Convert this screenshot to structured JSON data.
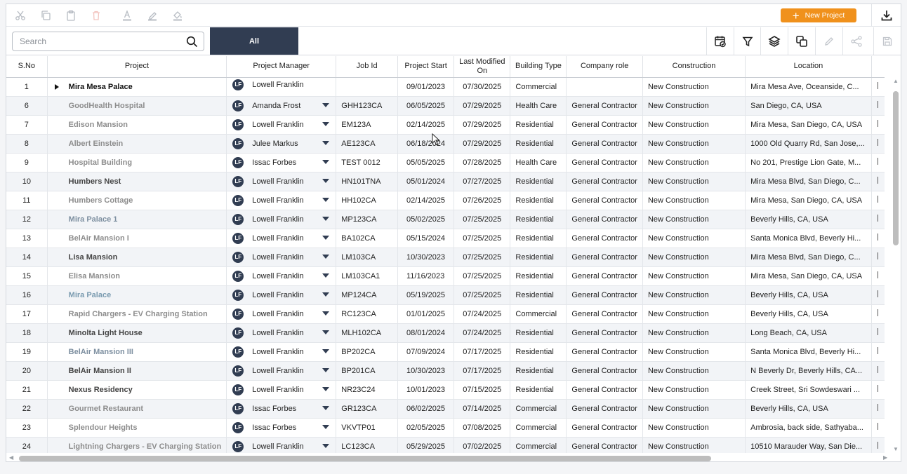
{
  "toolbar": {
    "icons": [
      "scissors-icon",
      "copy-icon",
      "paste-icon",
      "delete-icon",
      "font-color-icon",
      "highlight-icon",
      "fill-icon"
    ],
    "new_project_label": "New Project",
    "accent": "#f0911c"
  },
  "search": {
    "placeholder": "Search"
  },
  "tabs": [
    {
      "label": "All",
      "active": true
    }
  ],
  "actions": [
    "calendar-check-icon",
    "filter-icon",
    "layers-icon",
    "duplicate-icon",
    "edit-icon",
    "share-icon",
    "save-icon"
  ],
  "columns": [
    "S.No",
    "Project",
    "Project Manager",
    "Job Id",
    "Project Start",
    "Last Modified On",
    "Building Type",
    "Company role",
    "Construction",
    "Location"
  ],
  "rows": [
    {
      "no": "1",
      "project": "Mira Mesa Palace",
      "pm": "Lowell Franklin",
      "job": "",
      "start": "09/01/2023",
      "modified": "07/30/2025",
      "type": "Commercial",
      "role": "",
      "construction": "New Construction",
      "location": "Mira Mesa Ave, Oceanside, C..."
    },
    {
      "no": "6",
      "project": "GoodHealth Hospital",
      "pm": "Amanda Frost",
      "job": "GHH123CA",
      "start": "06/05/2025",
      "modified": "07/29/2025",
      "type": "Health Care",
      "role": "General Contractor",
      "construction": "New Construction",
      "location": "San Diego, CA, USA"
    },
    {
      "no": "7",
      "project": "Edison Mansion",
      "pm": "Lowell Franklin",
      "job": "EM123A",
      "start": "02/14/2025",
      "modified": "07/29/2025",
      "type": "Residential",
      "role": "General Contractor",
      "construction": "New Construction",
      "location": "Mira Mesa, San Diego, CA, USA"
    },
    {
      "no": "8",
      "project": "Albert Einstein",
      "pm": "Julee Markus",
      "job": "AE123CA",
      "start": "06/18/2024",
      "modified": "07/29/2025",
      "type": "Residential",
      "role": "General Contractor",
      "construction": "New Construction",
      "location": "1000 Old Quarry Rd, San Jose,..."
    },
    {
      "no": "9",
      "project": "Hospital Building",
      "pm": "Issac Forbes",
      "job": "TEST 0012",
      "start": "05/05/2025",
      "modified": "07/28/2025",
      "type": "Health Care",
      "role": "General Contractor",
      "construction": "New Construction",
      "location": "No 201, Prestige Lion Gate, M..."
    },
    {
      "no": "10",
      "project": "Humbers Nest",
      "pm": "Lowell Franklin",
      "job": "HN101TNA",
      "start": "05/01/2024",
      "modified": "07/27/2025",
      "type": "Residential",
      "role": "General Contractor",
      "construction": "New Construction",
      "location": "Mira Mesa Blvd, San Diego, C..."
    },
    {
      "no": "11",
      "project": "Humbers Cottage",
      "pm": "Lowell Franklin",
      "job": "HH102CA",
      "start": "02/14/2025",
      "modified": "07/26/2025",
      "type": "Residential",
      "role": "General Contractor",
      "construction": "New Construction",
      "location": "Mira Mesa, San Diego, CA, USA"
    },
    {
      "no": "12",
      "project": "Mira Palace 1",
      "pm": "Lowell Franklin",
      "job": "MP123CA",
      "start": "05/02/2025",
      "modified": "07/25/2025",
      "type": "Residential",
      "role": "General Contractor",
      "construction": "New Construction",
      "location": "Beverly Hills, CA, USA"
    },
    {
      "no": "13",
      "project": "BelAir Mansion I",
      "pm": "Lowell Franklin",
      "job": "BA102CA",
      "start": "05/15/2024",
      "modified": "07/25/2025",
      "type": "Residential",
      "role": "General Contractor",
      "construction": "New Construction",
      "location": "Santa Monica Blvd, Beverly Hi..."
    },
    {
      "no": "14",
      "project": "Lisa Mansion",
      "pm": "Lowell Franklin",
      "job": "LM103CA",
      "start": "10/30/2023",
      "modified": "07/25/2025",
      "type": "Residential",
      "role": "General Contractor",
      "construction": "New Construction",
      "location": "Mira Mesa Blvd, San Diego, C..."
    },
    {
      "no": "15",
      "project": "Elisa Mansion",
      "pm": "Lowell Franklin",
      "job": "LM103CA1",
      "start": "11/16/2023",
      "modified": "07/25/2025",
      "type": "Residential",
      "role": "General Contractor",
      "construction": "New Construction",
      "location": "Mira Mesa, San Diego, CA, USA"
    },
    {
      "no": "16",
      "project": "Mira Palace",
      "pm": "Lowell Franklin",
      "job": "MP124CA",
      "start": "05/19/2025",
      "modified": "07/25/2025",
      "type": "Residential",
      "role": "General Contractor",
      "construction": "New Construction",
      "location": "Beverly Hills, CA, USA"
    },
    {
      "no": "17",
      "project": "Rapid Chargers - EV Charging Station",
      "pm": "Lowell Franklin",
      "job": "RC123CA",
      "start": "01/01/2025",
      "modified": "07/24/2025",
      "type": "Commercial",
      "role": "General Contractor",
      "construction": "New Construction",
      "location": "Beverly Hills, CA, USA"
    },
    {
      "no": "18",
      "project": "Minolta Light House",
      "pm": "Lowell Franklin",
      "job": "MLH102CA",
      "start": "08/01/2024",
      "modified": "07/24/2025",
      "type": "Residential",
      "role": "General Contractor",
      "construction": "New Construction",
      "location": "Long Beach, CA, USA"
    },
    {
      "no": "19",
      "project": "BelAir Mansion III",
      "pm": "Lowell Franklin",
      "job": "BP202CA",
      "start": "07/09/2024",
      "modified": "07/17/2025",
      "type": "Residential",
      "role": "General Contractor",
      "construction": "New Construction",
      "location": "Santa Monica Blvd, Beverly Hi..."
    },
    {
      "no": "20",
      "project": "BelAir Mansion II",
      "pm": "Lowell Franklin",
      "job": "BP201CA",
      "start": "10/30/2023",
      "modified": "07/17/2025",
      "type": "Residential",
      "role": "General Contractor",
      "construction": "New Construction",
      "location": "N Beverly Dr, Beverly Hills, CA..."
    },
    {
      "no": "21",
      "project": "Nexus Residency",
      "pm": "Lowell Franklin",
      "job": "NR23C24",
      "start": "10/01/2023",
      "modified": "07/15/2025",
      "type": "Residential",
      "role": "General Contractor",
      "construction": "New Construction",
      "location": "Creek Street, Sri Sowdeswari ..."
    },
    {
      "no": "22",
      "project": "Gourmet Restaurant",
      "pm": "Issac Forbes",
      "job": "GR123CA",
      "start": "06/02/2025",
      "modified": "07/14/2025",
      "type": "Commercial",
      "role": "General Contractor",
      "construction": "New Construction",
      "location": "Beverly Hills, CA, USA"
    },
    {
      "no": "23",
      "project": "Splendour Heights",
      "pm": "Issac Forbes",
      "job": "VKVTP01",
      "start": "02/05/2025",
      "modified": "07/08/2025",
      "type": "Commercial",
      "role": "General Contractor",
      "construction": "New Construction",
      "location": "Ambrosia, back side, Sathyaba..."
    },
    {
      "no": "24",
      "project": "Lightning Chargers - EV Charging Station",
      "pm": "Lowell Franklin",
      "job": "LC123CA",
      "start": "05/29/2025",
      "modified": "07/02/2025",
      "type": "Commercial",
      "role": "General Contractor",
      "construction": "New Construction",
      "location": "10510 Marauder Way, San Die..."
    }
  ],
  "avatar_initials": "LF"
}
